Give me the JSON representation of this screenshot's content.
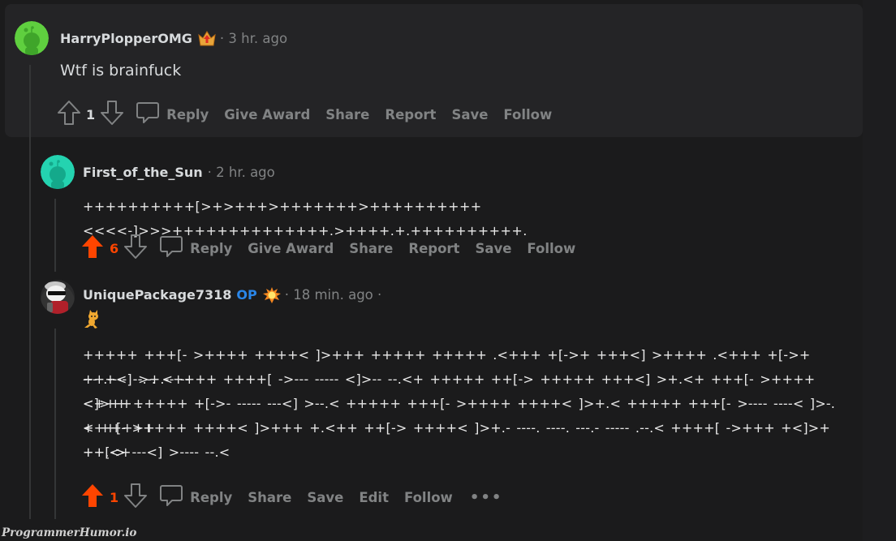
{
  "comments": [
    {
      "username": "HarryPlopperOMG",
      "award_icon": "crown-upvote-award-icon",
      "time": "· 3 hr. ago",
      "body": "Wtf is brainfuck",
      "votes": "1",
      "upvoted": false,
      "actions": [
        "Reply",
        "Give Award",
        "Share",
        "Report",
        "Save",
        "Follow"
      ],
      "avatar_color": "#5fcf3f"
    },
    {
      "username": "First_of_the_Sun",
      "time": "· 2 hr. ago",
      "body": "++++++++++[>+>+++>+++++++>++++++++++<<<<-]>>>++++++++++++++.>++++.+.++++++++++.",
      "votes": "6",
      "upvoted": true,
      "actions": [
        "Reply",
        "Give Award",
        "Share",
        "Report",
        "Save",
        "Follow"
      ],
      "avatar_color": "#24d3b0"
    },
    {
      "username": "UniquePackage7318",
      "op_badge": "OP",
      "award_icon": "explosion-award-icon",
      "time": "· 18 min. ago ·",
      "flair_icon": "scratch-cat-icon",
      "body_lines": [
        "+++++ +++[- >++++ ++++< ]>+++ +++++ +++++ .<+++ +[->+ +++<] >++++ .<+++ +[->+ +++<] >+.-- --",
        "--- .---- --.-. <++++ ++++[ ->--- ----- <]>-- --.<+ +++++ ++[-> +++++ +++<] >+.<+ +++[- >++++ <]>++ .",
        "<+++ +++++ +[->- ----- ---<] >--.< +++++ +++[- >++++ ++++< ]>+.< +++++ +++[- >---- ----< ]>-.< +++++",
        "+++[- >++++ ++++< ]>+++ +.<++ ++[-> ++++< ]>+.- ----. ----. ---.- ----- .--.< ++++[ ->+++ +<]>+ ++.<+",
        "++[-> ---<] >---- --.<"
      ],
      "votes": "1",
      "upvoted": true,
      "actions": [
        "Reply",
        "Share",
        "Save",
        "Edit",
        "Follow"
      ],
      "more_label": "•••"
    }
  ],
  "colors": {
    "upvote": "#ff4500",
    "op": "#2a86e8",
    "muted": "#818384"
  },
  "watermark": "ProgrammerHumor.io"
}
